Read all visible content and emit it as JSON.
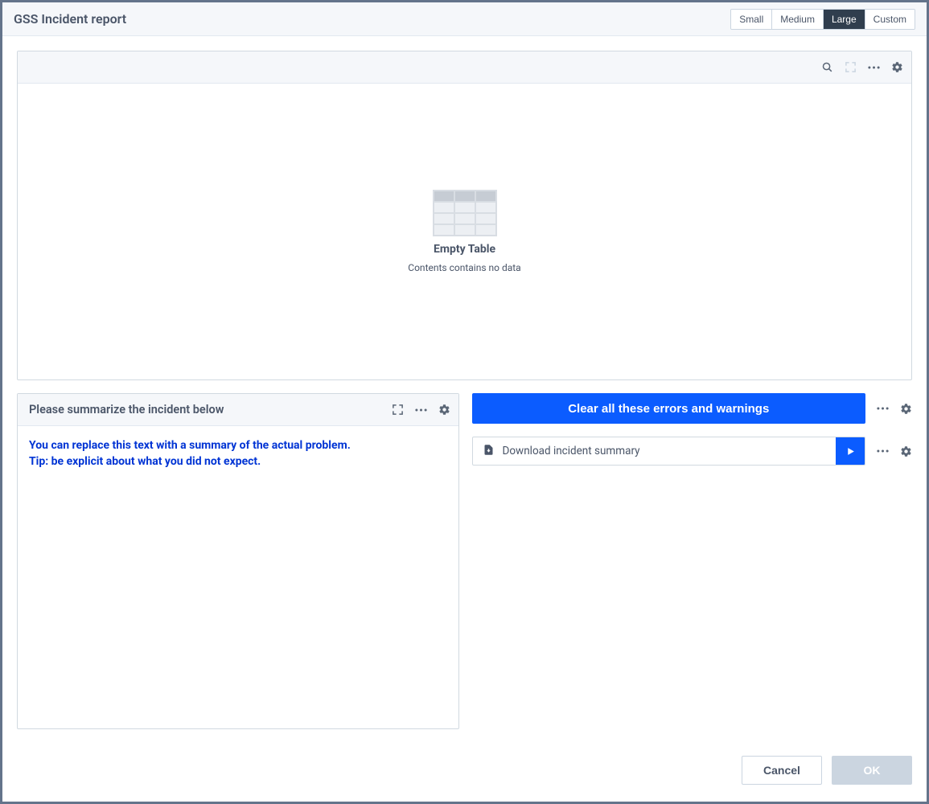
{
  "header": {
    "title": "GSS Incident report",
    "sizes": [
      "Small",
      "Medium",
      "Large",
      "Custom"
    ],
    "active_size": "Large"
  },
  "table_panel": {
    "empty_title": "Empty Table",
    "empty_subtitle": "Contents contains no data"
  },
  "summary_panel": {
    "title": "Please summarize the incident below",
    "line1": "You can replace this text with a summary of the actual problem.",
    "line2": "Tip: be explicit about what you did not expect."
  },
  "actions": {
    "clear_label": "Clear all these errors and warnings",
    "download_label": "Download incident summary"
  },
  "footer": {
    "cancel_label": "Cancel",
    "ok_label": "OK"
  }
}
